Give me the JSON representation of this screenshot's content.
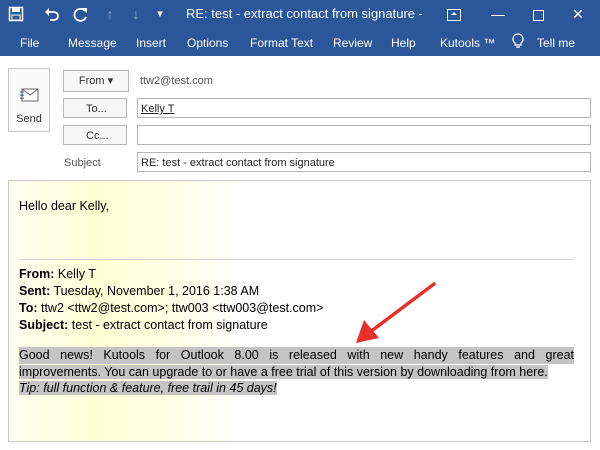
{
  "window": {
    "title": "RE: test - extract contact from signature  -  Mes..."
  },
  "ribbon": {
    "tabs": [
      "File",
      "Message",
      "Insert",
      "Options",
      "Format Text",
      "Review",
      "Help",
      "Kutools ™",
      "Tell me"
    ]
  },
  "header": {
    "send_label": "Send",
    "from_label": "From ▾",
    "from_address": "ttw2@test.com",
    "to_label": "To...",
    "to_value": "Kelly T",
    "cc_label": "Cc...",
    "cc_value": "",
    "subject_label": "Subject",
    "subject_value": "RE: test - extract contact from signature"
  },
  "body": {
    "greeting": "Hello dear Kelly,",
    "quoted": {
      "from_label": "From:",
      "from_value": " Kelly T",
      "sent_label": "Sent:",
      "sent_value": " Tuesday, November 1, 2016 1:38 AM",
      "to_label": "To:",
      "to_value": " ttw2 <ttw2@test.com>; ttw003 <ttw003@test.com>",
      "subject_label": "Subject:",
      "subject_value": " test - extract contact from signature"
    },
    "message_line1": "Good news! Kutools for Outlook 8.00 is released with new handy features and great",
    "message_line2": "improvements. You can upgrade to or have a free trial of this version by downloading from here.",
    "tip": "Tip: full function & feature, free trail in 45 days!"
  },
  "colors": {
    "accent": "#2b579a",
    "highlight": "#c4c4c4",
    "annotation_arrow": "#e8302a"
  }
}
